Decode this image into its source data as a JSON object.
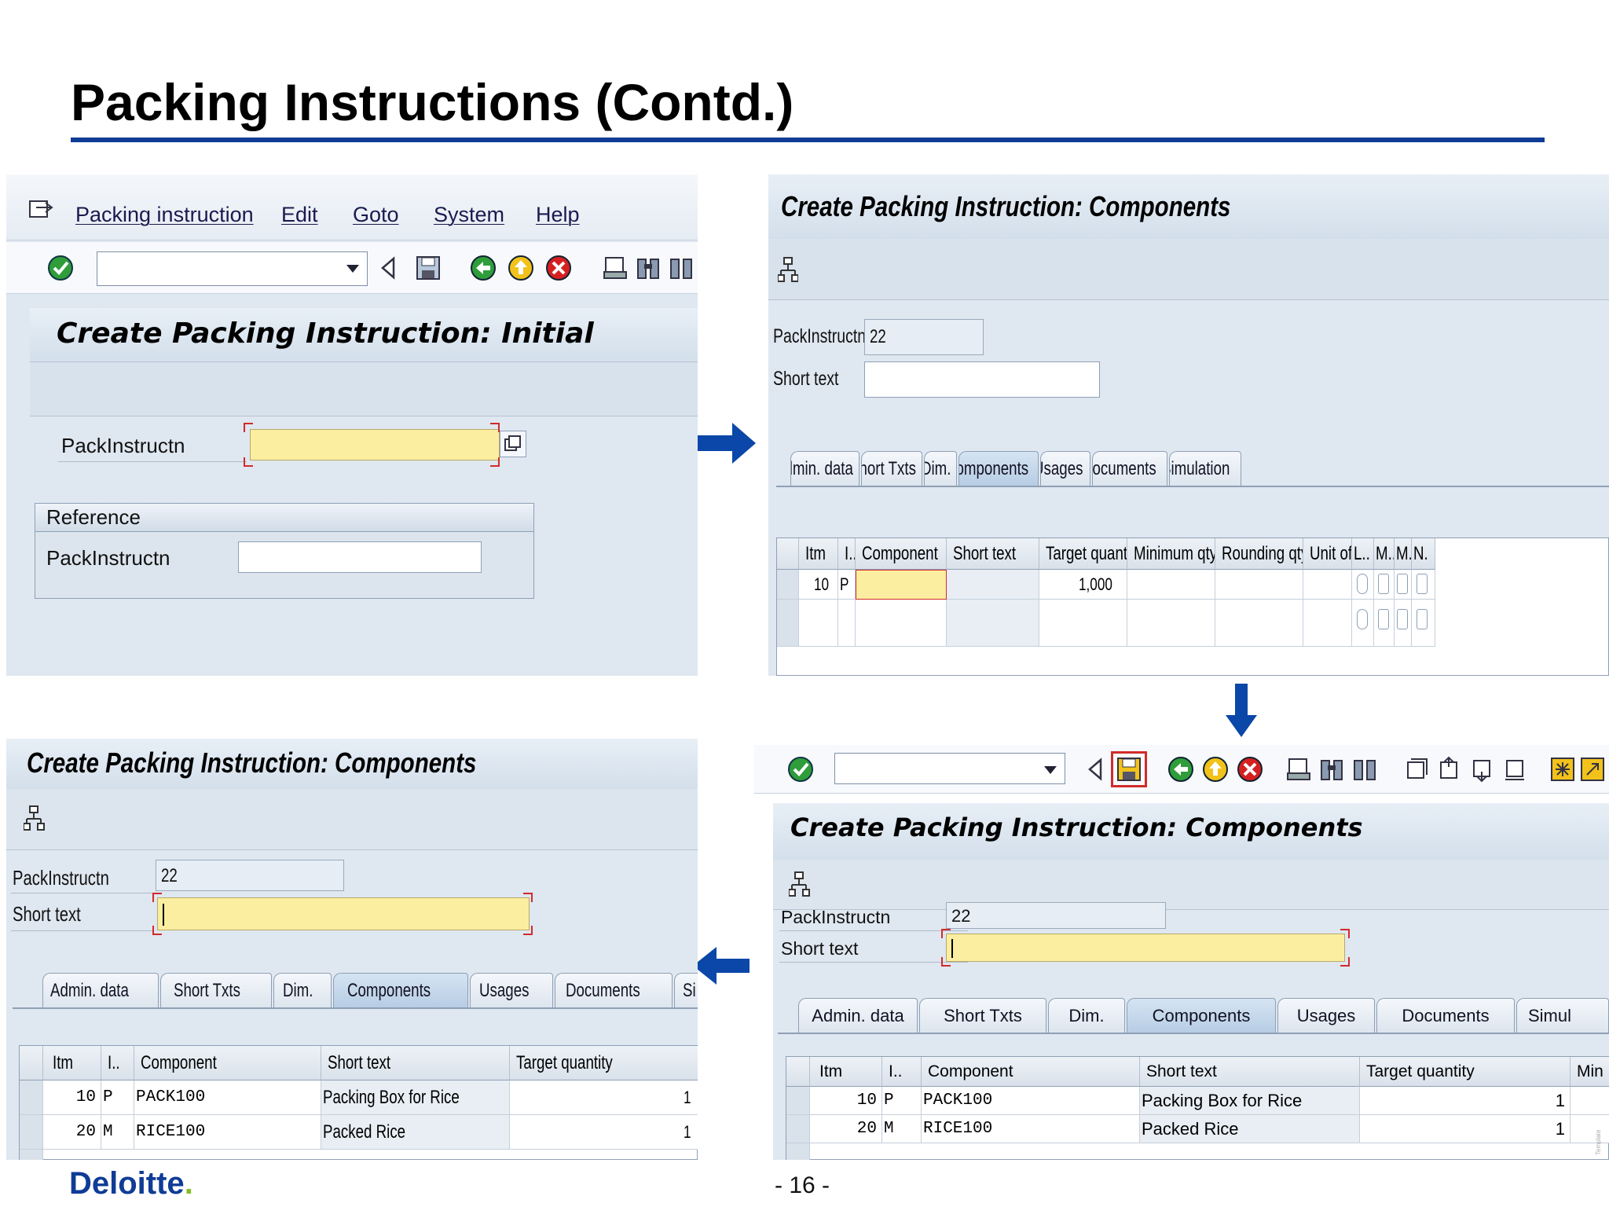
{
  "slide": {
    "title": "Packing Instructions (Contd.)",
    "footer_logo": "Deloitte",
    "footer_logo_dot": ".",
    "page_number": "- 16 -",
    "template_mark": "Template"
  },
  "panel1": {
    "menu": [
      "Packing instruction",
      "Edit",
      "Goto",
      "System",
      "Help"
    ],
    "header": "Create Packing Instruction: Initial",
    "pack_label": "PackInstructn",
    "reference_group": "Reference",
    "ref_pack_label": "PackInstructn"
  },
  "panel2": {
    "header": "Create Packing Instruction: Components",
    "pack_label": "PackInstructn",
    "pack_value": "22",
    "short_text_label": "Short text",
    "tabs": [
      "Admin. data",
      "Short Txts",
      "Dim.",
      "Components",
      "Usages",
      "Documents",
      "Simulation"
    ],
    "columns": [
      "Itm",
      "I..",
      "Component",
      "Short text",
      "Target quantity",
      "Minimum qty",
      "Rounding qty",
      "Unit of ...",
      "L..",
      "M...",
      "M.",
      "N."
    ],
    "row1": {
      "item": "10",
      "cat": "P",
      "target": "1,000"
    }
  },
  "panel3": {
    "header": "Create Packing Instruction: Components",
    "pack_label": "PackInstructn",
    "pack_value": "22",
    "short_text_label": "Short text",
    "tabs": [
      "Admin. data",
      "Short Txts",
      "Dim.",
      "Components",
      "Usages",
      "Documents",
      "Si"
    ],
    "columns": [
      "Itm",
      "I..",
      "Component",
      "Short text",
      "Target quantity"
    ],
    "rows": [
      {
        "item": "10",
        "cat": "P",
        "component": "PACK100",
        "short_text": "Packing Box for Rice",
        "target": "1"
      },
      {
        "item": "20",
        "cat": "M",
        "component": "RICE100",
        "short_text": "Packed Rice",
        "target": "1"
      }
    ]
  },
  "panel4": {
    "header": "Create Packing Instruction: Components",
    "pack_label": "PackInstructn",
    "pack_value": "22",
    "short_text_label": "Short text",
    "tabs": [
      "Admin. data",
      "Short Txts",
      "Dim.",
      "Components",
      "Usages",
      "Documents",
      "Simul"
    ],
    "columns": [
      "Itm",
      "I..",
      "Component",
      "Short text",
      "Target quantity",
      "Min"
    ],
    "rows": [
      {
        "item": "10",
        "cat": "P",
        "component": "PACK100",
        "short_text": "Packing Box for Rice",
        "target": "1"
      },
      {
        "item": "20",
        "cat": "M",
        "component": "RICE100",
        "short_text": "Packed Rice",
        "target": "1"
      }
    ]
  },
  "colors": {
    "brand_blue": "#0f3c96",
    "arrow_blue": "#0b47a8",
    "required_yellow": "#fbeea0",
    "highlight_red": "#d12b2b",
    "deloitte_green": "#86bc25"
  }
}
